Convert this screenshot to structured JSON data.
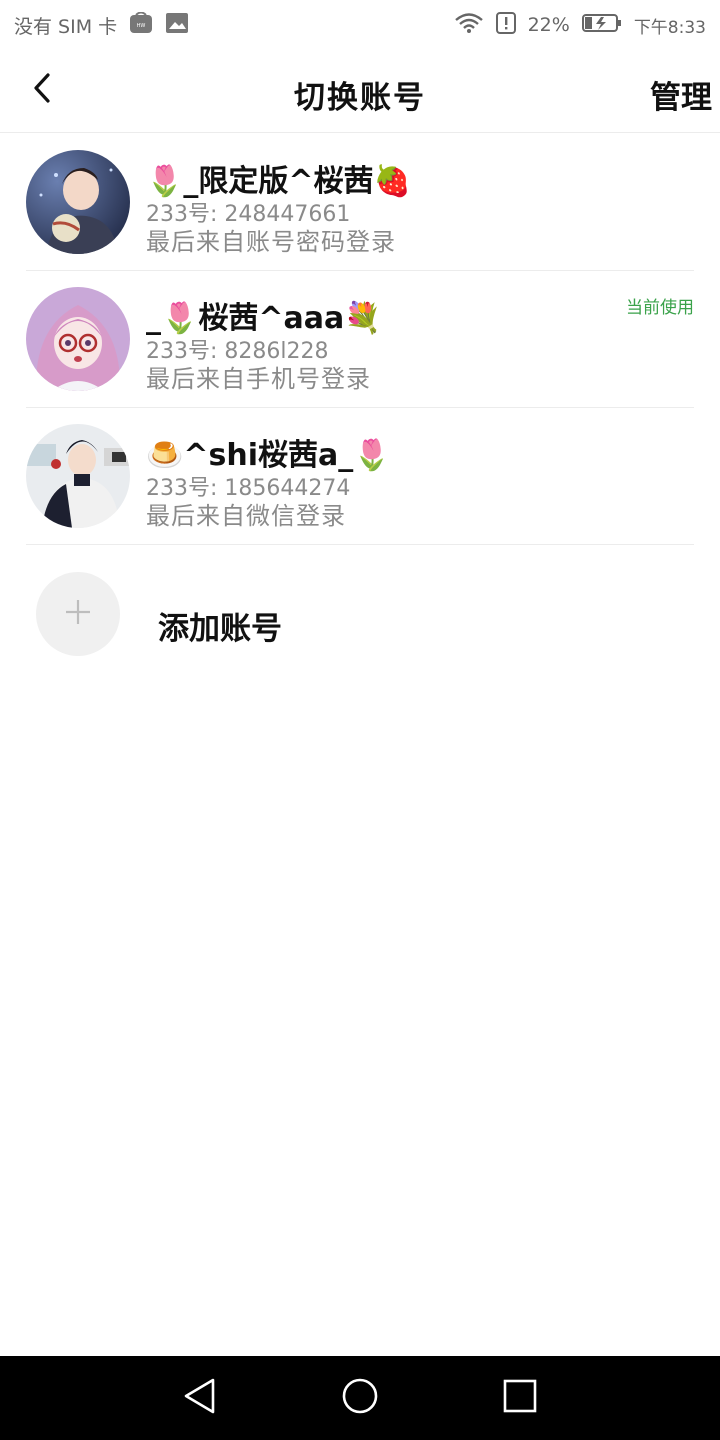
{
  "status_bar": {
    "carrier": "没有 SIM 卡",
    "battery_percent": "22%",
    "time": "下午8:33",
    "icons": [
      "huawei-store-icon",
      "image-icon",
      "wifi-icon",
      "alert-icon",
      "battery-charging-icon"
    ]
  },
  "header": {
    "title": "切换账号",
    "manage_label": "管理",
    "back_icon": "chevron-left-icon"
  },
  "accounts": [
    {
      "name": "🌷_限定版^桜茜🍓",
      "id_line": "233号: 248447661",
      "last_login": "最后来自账号密码登录",
      "current": ""
    },
    {
      "name": "_🌷桜茜^aaa💐",
      "id_line": "233号: 8286l228",
      "last_login": "最后来自手机号登录",
      "current": "当前使用"
    },
    {
      "name": "🍮^shi桜茜a_🌷",
      "id_line": "233号: 185644274",
      "last_login": "最后来自微信登录",
      "current": ""
    }
  ],
  "add_account": {
    "label": "添加账号",
    "icon": "plus-icon"
  },
  "colors": {
    "accent_green": "#3aa24a",
    "secondary_text": "#8a8a8a",
    "divider": "#ececec",
    "nav_bar": "#000000"
  }
}
